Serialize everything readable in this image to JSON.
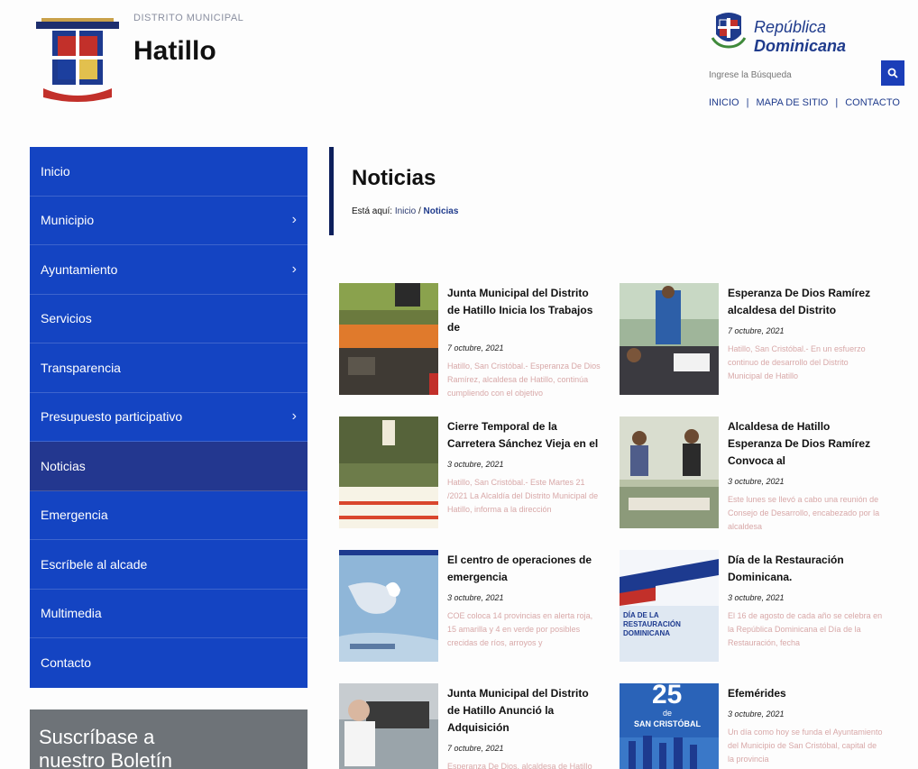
{
  "header": {
    "muni_label": "DISTRITO MUNICIPAL",
    "muni_name": "Hatillo",
    "rd_brand_italic": "República",
    "rd_brand_bold": "Dominicana",
    "search_placeholder": "Ingrese la Búsqueda",
    "top_links": [
      "INICIO",
      "MAPA DE SITIO",
      "CONTACTO"
    ],
    "separator": "|"
  },
  "sidebar": {
    "items": [
      {
        "label": "Inicio",
        "has_children": false,
        "active": false
      },
      {
        "label": "Municipio",
        "has_children": true,
        "active": false
      },
      {
        "label": "Ayuntamiento",
        "has_children": true,
        "active": false
      },
      {
        "label": "Servicios",
        "has_children": false,
        "active": false
      },
      {
        "label": "Transparencia",
        "has_children": false,
        "active": false
      },
      {
        "label": "Presupuesto participativo",
        "has_children": true,
        "active": false
      },
      {
        "label": "Noticias",
        "has_children": false,
        "active": true
      },
      {
        "label": "Emergencia",
        "has_children": false,
        "active": false
      },
      {
        "label": "Escríbele al alcade",
        "has_children": false,
        "active": false
      },
      {
        "label": "Multimedia",
        "has_children": false,
        "active": false
      },
      {
        "label": "Contacto",
        "has_children": false,
        "active": false
      }
    ],
    "chevron": "›",
    "subscribe_line1": "Suscríbase a",
    "subscribe_line2": "nuestro Boletín"
  },
  "main": {
    "title": "Noticias",
    "breadcrumb_prefix": "Está aquí:",
    "breadcrumb_home": "Inicio",
    "breadcrumb_sep": "/",
    "breadcrumb_current": "Noticias"
  },
  "news": [
    {
      "title": "Junta Municipal del Distrito de Hatillo Inicia los Trabajos de",
      "date": "7 octubre, 2021",
      "excerpt": "Hatillo, San Cristóbal.- Esperanza De Dios Ramírez, alcaldesa de Hatillo, continúa cumpliendo con el objetivo"
    },
    {
      "title": "Esperanza De Dios Ramírez alcaldesa del Distrito",
      "date": "7 octubre, 2021",
      "excerpt": "Hatillo, San Cristóbal.- En un esfuerzo continuo de desarrollo del Distrito Municipal de Hatillo"
    },
    {
      "title": "Cierre Temporal de la Carretera Sánchez Vieja en el",
      "date": "3 octubre, 2021",
      "excerpt": "Hatillo, San Cristóbal.- Este Martes 21 /2021 La Alcaldía del Distrito Municipal de Hatillo, informa a la dirección"
    },
    {
      "title": "Alcaldesa de Hatillo Esperanza De Dios Ramírez Convoca al",
      "date": "3 octubre, 2021",
      "excerpt": "Este lunes se llevó a cabo una reunión de Consejo de Desarrollo, encabezado por la alcaldesa"
    },
    {
      "title": "El centro de operaciones de emergencia",
      "date": "3 octubre, 2021",
      "excerpt": "COE coloca 14 provincias en alerta roja, 15 amarilla y 4 en verde por posibles crecidas de ríos, arroyos y"
    },
    {
      "title": "Día de la Restauración Dominicana.",
      "date": "3 octubre, 2021",
      "excerpt": "El 16 de agosto de cada año se celebra en la República Dominicana el Día de la Restauración, fecha"
    },
    {
      "title": "Junta Municipal del Distrito de Hatillo Anunció la Adquisición",
      "date": "7 octubre, 2021",
      "excerpt": "Esperanza De Dios, alcaldesa de Hatillo anunció la adquisición de"
    },
    {
      "title": "Efemérides",
      "date": "3 octubre, 2021",
      "excerpt": "Un día como hoy se funda el Ayuntamiento del Municipio de San Cristóbal, capital de la provincia"
    }
  ],
  "thumb_text": {
    "restauracion": "DÍA DE LA RESTAURACIÓN DOMINICANA",
    "efemerides_num": "25",
    "efemerides_sub": "de",
    "efemerides_city": "SAN CRISTÓBAL"
  },
  "colors": {
    "sidebar_bg": "#1444c2",
    "sidebar_active": "#23378f",
    "accent_blue": "#1b3eb8",
    "title_bar": "#0c1f5c"
  }
}
